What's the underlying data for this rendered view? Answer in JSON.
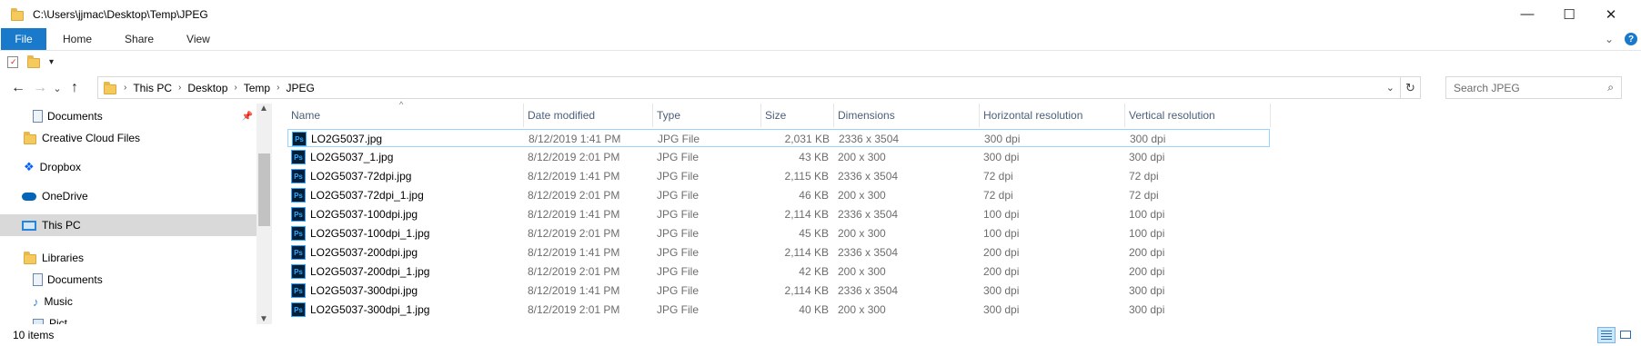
{
  "window": {
    "title": "C:\\Users\\jjmac\\Desktop\\Temp\\JPEG",
    "minimize": "—",
    "maximize": "☐",
    "close": "✕"
  },
  "ribbon": {
    "tabs": [
      "File",
      "Home",
      "Share",
      "View"
    ],
    "help": "?"
  },
  "nav": {
    "back": "←",
    "forward": "→",
    "recent": "⌄",
    "up": "↑"
  },
  "address": {
    "crumbs": [
      "This PC",
      "Desktop",
      "Temp",
      "JPEG"
    ],
    "separator": "›",
    "refresh": "↻"
  },
  "search": {
    "placeholder": "Search JPEG"
  },
  "navpane": {
    "items": [
      {
        "label": "Documents",
        "icon": "documents-icon"
      },
      {
        "label": "Creative Cloud Files",
        "icon": "creative-cloud-icon"
      },
      {
        "label": "Dropbox",
        "icon": "dropbox-icon"
      },
      {
        "label": "OneDrive",
        "icon": "onedrive-icon"
      },
      {
        "label": "This PC",
        "icon": "this-pc-icon"
      },
      {
        "label": "Libraries",
        "icon": "libraries-icon"
      },
      {
        "label": "Documents",
        "icon": "documents-icon"
      },
      {
        "label": "Music",
        "icon": "music-icon"
      },
      {
        "label": "Pict",
        "icon": "pictures-icon"
      }
    ]
  },
  "columns": [
    "Name",
    "Date modified",
    "Type",
    "Size",
    "Dimensions",
    "Horizontal resolution",
    "Vertical resolution"
  ],
  "files": [
    {
      "name": "LO2G5037.jpg",
      "date": "8/12/2019 1:41 PM",
      "type": "JPG File",
      "size": "2,031 KB",
      "dims": "2336 x 3504",
      "hres": "300 dpi",
      "vres": "300 dpi"
    },
    {
      "name": "LO2G5037_1.jpg",
      "date": "8/12/2019 2:01 PM",
      "type": "JPG File",
      "size": "43 KB",
      "dims": "200 x 300",
      "hres": "300 dpi",
      "vres": "300 dpi"
    },
    {
      "name": "LO2G5037-72dpi.jpg",
      "date": "8/12/2019 1:41 PM",
      "type": "JPG File",
      "size": "2,115 KB",
      "dims": "2336 x 3504",
      "hres": "72 dpi",
      "vres": "72 dpi"
    },
    {
      "name": "LO2G5037-72dpi_1.jpg",
      "date": "8/12/2019 2:01 PM",
      "type": "JPG File",
      "size": "46 KB",
      "dims": "200 x 300",
      "hres": "72 dpi",
      "vres": "72 dpi"
    },
    {
      "name": "LO2G5037-100dpi.jpg",
      "date": "8/12/2019 1:41 PM",
      "type": "JPG File",
      "size": "2,114 KB",
      "dims": "2336 x 3504",
      "hres": "100 dpi",
      "vres": "100 dpi"
    },
    {
      "name": "LO2G5037-100dpi_1.jpg",
      "date": "8/12/2019 2:01 PM",
      "type": "JPG File",
      "size": "45 KB",
      "dims": "200 x 300",
      "hres": "100 dpi",
      "vres": "100 dpi"
    },
    {
      "name": "LO2G5037-200dpi.jpg",
      "date": "8/12/2019 1:41 PM",
      "type": "JPG File",
      "size": "2,114 KB",
      "dims": "2336 x 3504",
      "hres": "200 dpi",
      "vres": "200 dpi"
    },
    {
      "name": "LO2G5037-200dpi_1.jpg",
      "date": "8/12/2019 2:01 PM",
      "type": "JPG File",
      "size": "42 KB",
      "dims": "200 x 300",
      "hres": "200 dpi",
      "vres": "200 dpi"
    },
    {
      "name": "LO2G5037-300dpi.jpg",
      "date": "8/12/2019 1:41 PM",
      "type": "JPG File",
      "size": "2,114 KB",
      "dims": "2336 x 3504",
      "hres": "300 dpi",
      "vres": "300 dpi"
    },
    {
      "name": "LO2G5037-300dpi_1.jpg",
      "date": "8/12/2019 2:01 PM",
      "type": "JPG File",
      "size": "40 KB",
      "dims": "200 x 300",
      "hres": "300 dpi",
      "vres": "300 dpi"
    }
  ],
  "status": {
    "count": "10 items"
  },
  "colors": {
    "accent": "#1979ca",
    "selection": "#d9d9d9",
    "header_text": "#4c607a"
  }
}
